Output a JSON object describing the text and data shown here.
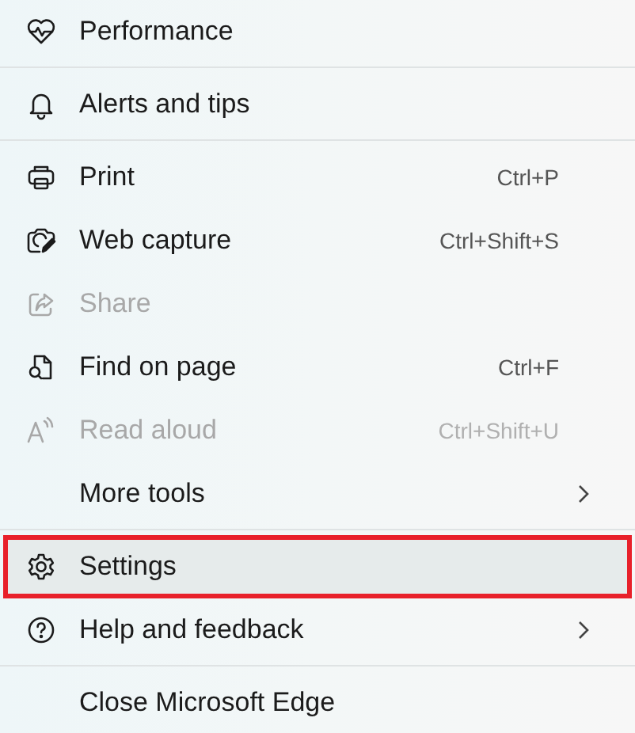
{
  "menu": {
    "groups": [
      {
        "items": [
          {
            "label": "Performance",
            "disabled": false,
            "selected": false
          }
        ]
      },
      {
        "items": [
          {
            "label": "Alerts and tips",
            "disabled": false,
            "selected": false
          }
        ]
      },
      {
        "items": [
          {
            "label": "Print",
            "shortcut": "Ctrl+P",
            "disabled": false,
            "selected": false
          },
          {
            "label": "Web capture",
            "shortcut": "Ctrl+Shift+S",
            "disabled": false,
            "selected": false
          },
          {
            "label": "Share",
            "disabled": true,
            "selected": false
          },
          {
            "label": "Find on page",
            "shortcut": "Ctrl+F",
            "disabled": false,
            "selected": false
          },
          {
            "label": "Read aloud",
            "shortcut": "Ctrl+Shift+U",
            "disabled": true,
            "selected": false
          },
          {
            "label": "More tools",
            "submenu": true,
            "disabled": false,
            "selected": false
          }
        ]
      },
      {
        "items": [
          {
            "label": "Settings",
            "disabled": false,
            "selected": true
          },
          {
            "label": "Help and feedback",
            "submenu": true,
            "disabled": false,
            "selected": false
          }
        ]
      },
      {
        "items": [
          {
            "label": "Close Microsoft Edge",
            "disabled": false,
            "selected": false
          }
        ]
      }
    ]
  }
}
